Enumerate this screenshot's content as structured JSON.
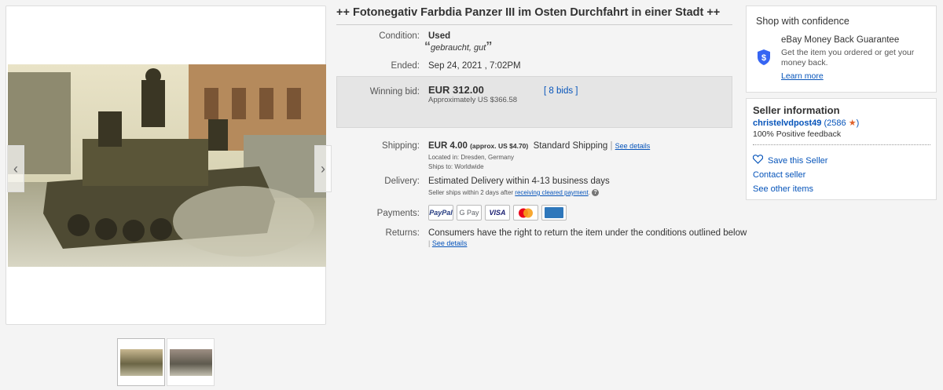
{
  "listing": {
    "title": "++ Fotonegativ Farbdia Panzer III im Osten Durchfahrt in einer Stadt ++",
    "condition_label": "Condition:",
    "condition_value": "Used",
    "condition_note_open": "“",
    "condition_note": "gebraucht, gut",
    "condition_note_close": "”",
    "ended_label": "Ended:",
    "ended_value": "Sep 24, 2021 , 7:02PM",
    "bid_label": "Winning bid:",
    "bid_value": "EUR 312.00",
    "bid_approx": "Approximately US $366.58",
    "bids_link": "8 bids",
    "bids_open": "[",
    "bids_close": "]",
    "shipping_label": "Shipping:",
    "shipping_value": "EUR 4.00",
    "shipping_approx": "(approx. US $4.70)",
    "shipping_method": "Standard Shipping",
    "shipping_sep": "|",
    "shipping_details": "See details",
    "located": "Located in:  Dresden, Germany",
    "ships_to": "Ships to:  Worldwide",
    "delivery_label": "Delivery:",
    "delivery_value": "Estimated Delivery within 4-13 business days",
    "delivery_note": "Seller ships within 2 days after",
    "delivery_link": "receiving cleared payment",
    "delivery_dot": ".",
    "payments_label": "Payments:",
    "payments": [
      "PayPal",
      "G Pay",
      "VISA",
      "",
      ""
    ],
    "returns_label": "Returns:",
    "returns_value": "Consumers have the right to return the item under the conditions outlined below",
    "returns_sep": "|",
    "returns_details": "See details"
  },
  "confidence": {
    "title": "Shop with confidence",
    "guarantee_title": "eBay Money Back Guarantee",
    "guarantee_text": "Get the item you ordered or get your money back.",
    "learn_more": "Learn more"
  },
  "seller": {
    "title": "Seller information",
    "name": "christelvdpost49",
    "score_open": "(",
    "score": "2586",
    "score_close": ")",
    "feedback": "100% Positive feedback",
    "save": "Save this Seller",
    "contact": "Contact seller",
    "other": "See other items"
  },
  "colors": {
    "link": "#0654ba",
    "star": "#e0612a",
    "shield": "#3665f3"
  },
  "icons": [
    "chevron-left-icon",
    "chevron-right-icon",
    "shield-dollar-icon",
    "star-icon",
    "heart-icon",
    "info-icon"
  ]
}
